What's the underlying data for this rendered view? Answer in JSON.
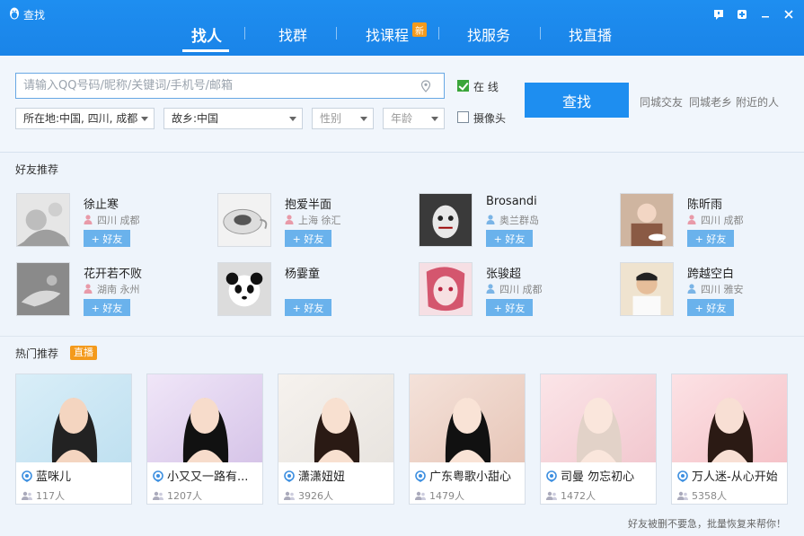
{
  "window": {
    "title": "查找"
  },
  "nav": {
    "items": [
      "找人",
      "找群",
      "找课程",
      "找服务",
      "找直播"
    ],
    "new_badge": "新"
  },
  "search": {
    "placeholder": "请输入QQ号码/昵称/关键词/手机号/邮箱",
    "online_label": "在  线",
    "camera_label": "摄像头",
    "button": "查找",
    "location": "所在地:中国, 四川, 成都",
    "hometown": "故乡:中国",
    "gender": "性别",
    "age": "年龄",
    "quick_links": [
      "同城交友",
      "同城老乡",
      "附近的人"
    ]
  },
  "friends": {
    "title": "好友推荐",
    "add_label": "+ 好友",
    "items": [
      {
        "name": "徐止寒",
        "location": "四川 成都",
        "gender": "female"
      },
      {
        "name": "抱爱半面",
        "location": "上海 徐汇",
        "gender": "female"
      },
      {
        "name": "Brosandi",
        "location": "奥兰群岛",
        "gender": "male"
      },
      {
        "name": "陈昕雨",
        "location": "四川 成都",
        "gender": "female"
      },
      {
        "name": "花开若不败",
        "location": "湖南 永州",
        "gender": "female"
      },
      {
        "name": "杨霎童",
        "location": "",
        "gender": ""
      },
      {
        "name": "张骏超",
        "location": "四川 成都",
        "gender": "male"
      },
      {
        "name": "跨越空白",
        "location": "四川 雅安",
        "gender": "male"
      }
    ]
  },
  "live": {
    "title": "热门推荐",
    "badge": "直播",
    "items": [
      {
        "name": "蓝咪儿",
        "count": "117人"
      },
      {
        "name": "小又又一路有...",
        "count": "1207人"
      },
      {
        "name": "潇潇妞妞",
        "count": "3926人"
      },
      {
        "name": "广东粤歌小甜心",
        "count": "1479人"
      },
      {
        "name": "司曼 勿忘初心",
        "count": "1472人"
      },
      {
        "name": "万人迷-从心开始",
        "count": "5358人"
      }
    ]
  },
  "footer": {
    "restore_link": "好友被删不要急，批量恢复来帮你！"
  },
  "colors": {
    "brand": "#1e8ef0",
    "accent": "#f49a1c",
    "add_button": "#6ab2ec"
  }
}
